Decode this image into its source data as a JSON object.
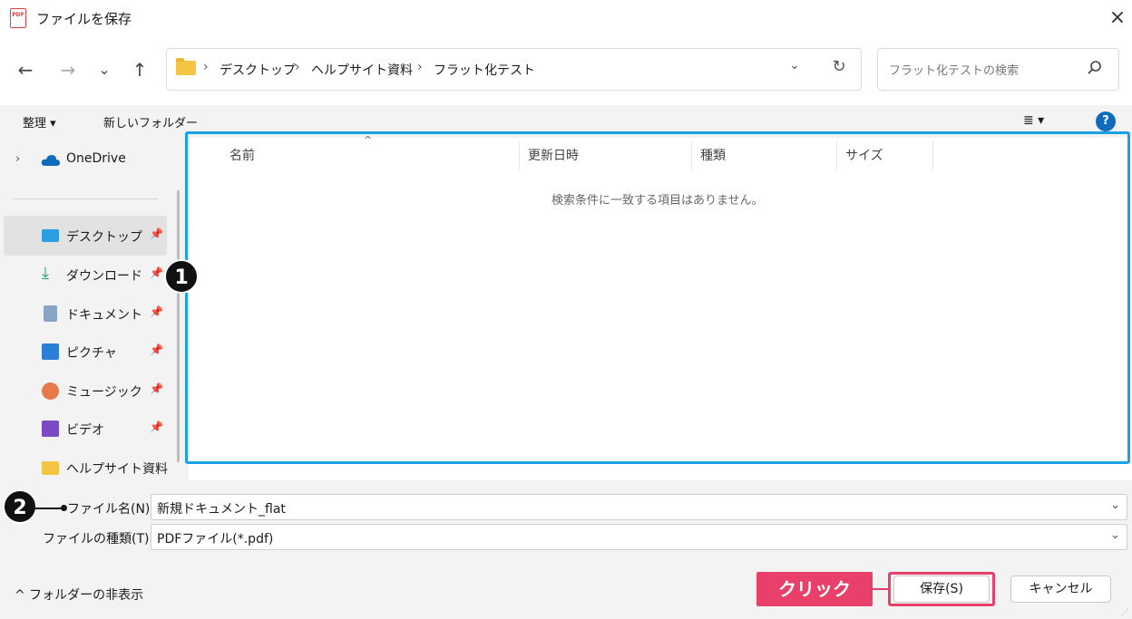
{
  "window": {
    "title": "ファイルを保存",
    "icon_text": "PDF",
    "close_icon": "×"
  },
  "nav": {
    "back_icon": "←",
    "forward_icon": "→",
    "recent_icon": "⌄",
    "up_icon": "↑"
  },
  "address": {
    "crumbs": [
      "デスクトップ",
      "ヘルプサイト資料",
      "フラット化テスト"
    ],
    "sep": "›",
    "dropdown_icon": "⌄",
    "refresh_icon": "↻"
  },
  "search": {
    "placeholder": "フラット化テストの検索"
  },
  "commands": {
    "organize": "整理 ▾",
    "new_folder": "新しいフォルダー",
    "view_icon": "≣ ▾",
    "help_icon": "?"
  },
  "sidebar": {
    "onedrive": "OneDrive",
    "items": [
      {
        "label": "デスクトップ",
        "pin": "📌"
      },
      {
        "label": "ダウンロード",
        "pin": "📌"
      },
      {
        "label": "ドキュメント",
        "pin": "📌"
      },
      {
        "label": "ピクチャ",
        "pin": "📌"
      },
      {
        "label": "ミュージック",
        "pin": "📌"
      },
      {
        "label": "ビデオ",
        "pin": "📌"
      },
      {
        "label": "ヘルプサイト資料",
        "pin": ""
      }
    ]
  },
  "filelist": {
    "columns": [
      "名前",
      "更新日時",
      "種類",
      "サイズ"
    ],
    "sort_icon": "^",
    "empty_message": "検索条件に一致する項目はありません。"
  },
  "annotations": {
    "badge1": "1",
    "badge2": "2",
    "click_label": "クリック",
    "highlight_color": "#1aa2e8",
    "accent_color": "#e8406a"
  },
  "form": {
    "filename_label": "ファイル名(N):",
    "filename_value": "新規ドキュメント_flat",
    "filetype_label": "ファイルの種類(T):",
    "filetype_value": "PDFファイル(*.pdf)",
    "dropdown_icon": "⌄"
  },
  "footer": {
    "hide_folders": "^ フォルダーの非表示",
    "save_button": "保存(S)",
    "cancel_button": "キャンセル"
  }
}
